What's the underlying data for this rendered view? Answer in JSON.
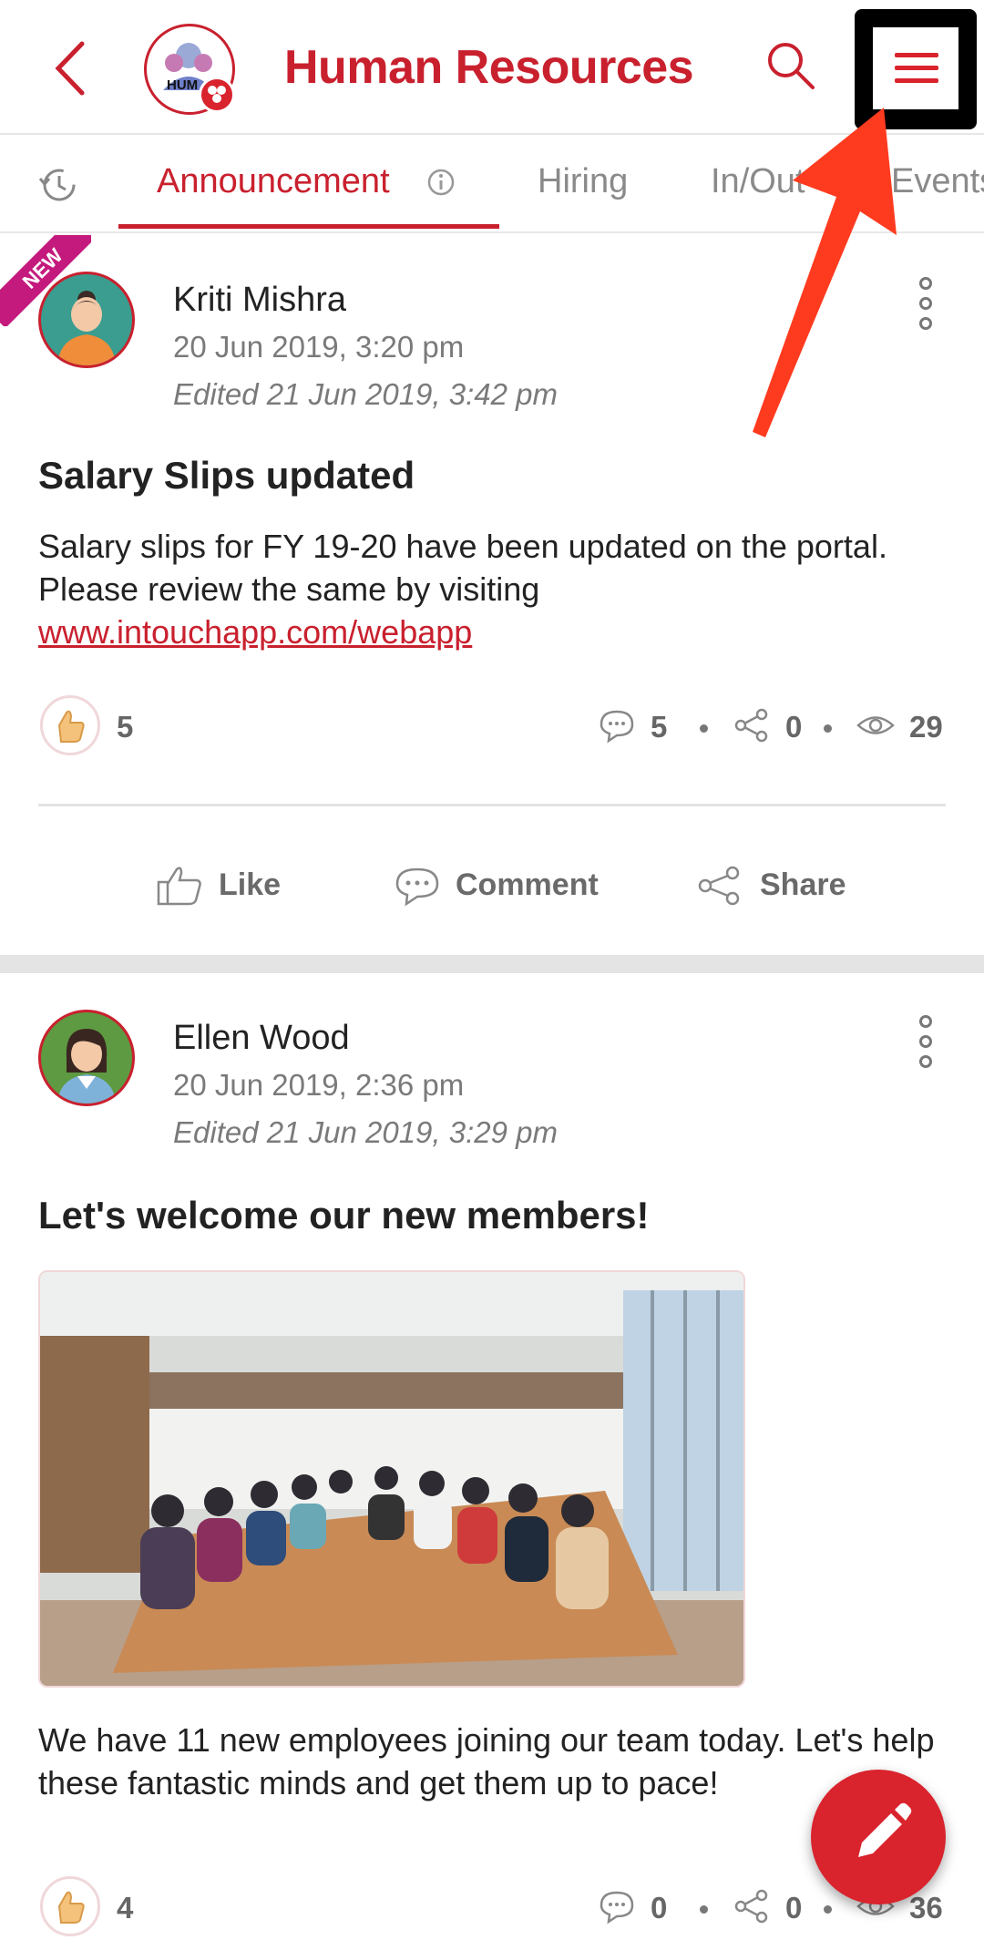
{
  "header": {
    "title": "Human Resources",
    "logo_text": "HUM",
    "accent_color": "#c9202e",
    "icons": [
      "back-icon",
      "search-icon",
      "menu-icon"
    ]
  },
  "tabs": {
    "items": [
      {
        "label": "",
        "icon": "history-icon"
      },
      {
        "label": "Announcement",
        "icon": "info-icon",
        "active": true
      },
      {
        "label": "Hiring"
      },
      {
        "label": "In/Out"
      },
      {
        "label": "Events"
      }
    ]
  },
  "posts": [
    {
      "badge": "NEW",
      "author": "Kriti Mishra",
      "date": "20 Jun 2019, 3:20 pm",
      "edited": "Edited 21 Jun 2019, 3:42 pm",
      "title": "Salary Slips updated",
      "body": "Salary slips for FY 19-20 have been updated on the portal. Please review the same by visiting",
      "link": "www.intouchapp.com/webapp",
      "likes": "5",
      "comments": "5",
      "shares": "0",
      "views": "29"
    },
    {
      "author": "Ellen Wood",
      "date": "20 Jun 2019, 2:36 pm",
      "edited": "Edited 21 Jun 2019, 3:29 pm",
      "title": "Let's welcome our new members!",
      "body": "We have 11 new employees joining our team today. Let's help these fantastic minds and get them up to pace!",
      "likes": "4",
      "comments": "0",
      "shares": "0",
      "views": "36"
    }
  ],
  "actions": {
    "like": "Like",
    "comment": "Comment",
    "share": "Share"
  },
  "fab": {
    "icon": "pencil-icon"
  },
  "annotation": {
    "color": "#ff3b1f"
  }
}
